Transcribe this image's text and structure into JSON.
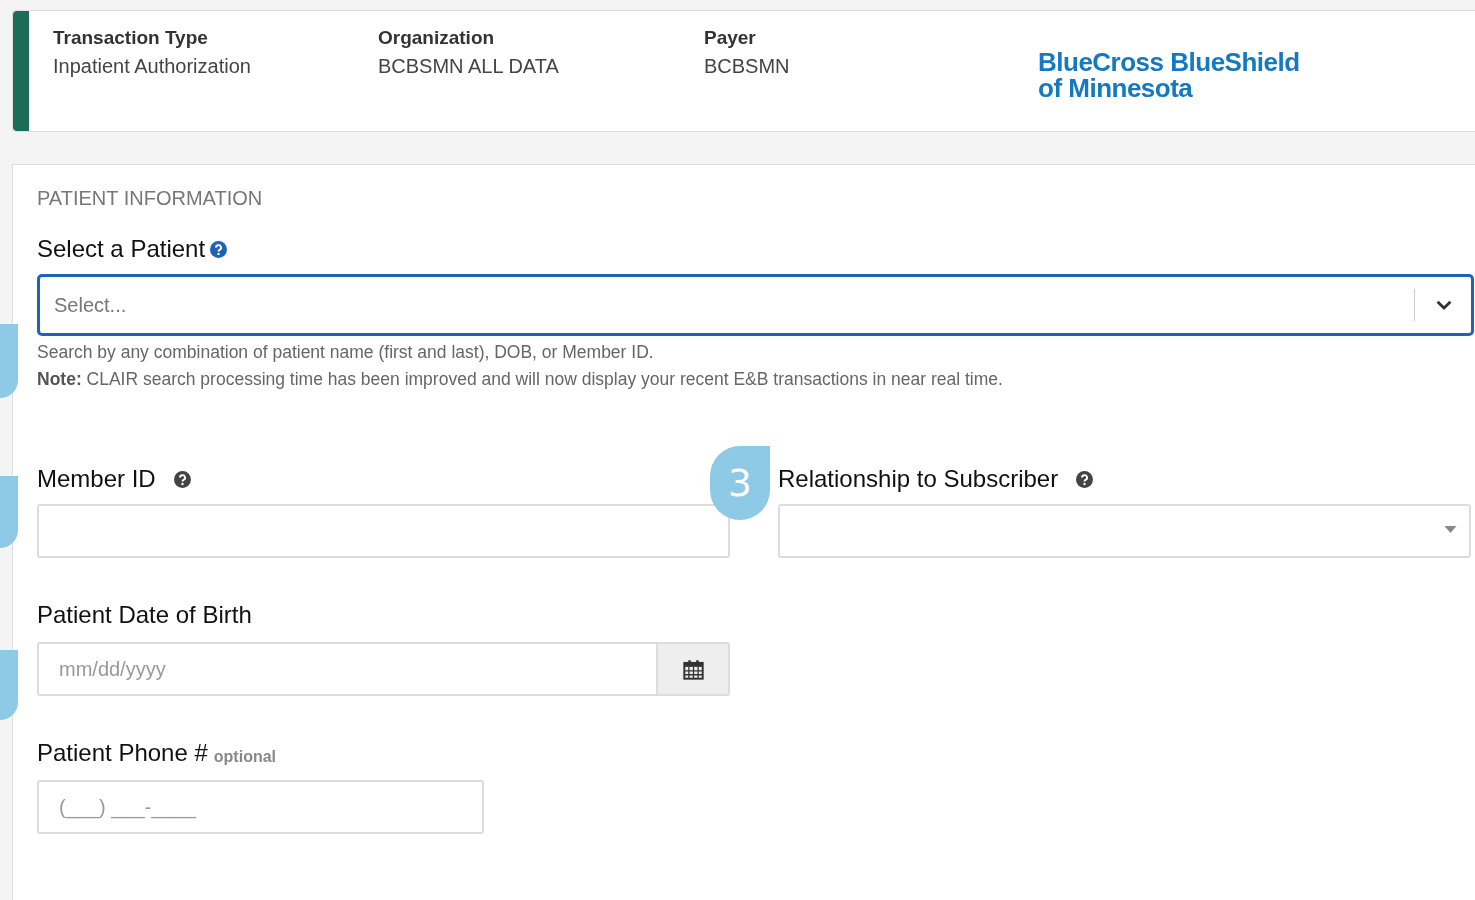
{
  "header": {
    "fields": [
      {
        "label": "Transaction Type",
        "value": "Inpatient Authorization"
      },
      {
        "label": "Organization",
        "value": "BCBSMN ALL DATA"
      },
      {
        "label": "Payer",
        "value": "BCBSMN"
      }
    ],
    "logo_lines": [
      "BlueCross BlueShield",
      "of Minnesota"
    ]
  },
  "section_title": "PATIENT INFORMATION",
  "select_patient": {
    "label": "Select a Patient",
    "placeholder": "Select...",
    "help": [
      "Search by any combination of patient name (first and last), DOB, or Member ID.",
      "**Note:** CLAIR search processing time has been improved and will now display your recent E&B transactions in near real time."
    ]
  },
  "member_id": {
    "label": "Member ID"
  },
  "relationship": {
    "label": "Relationship to Subscriber"
  },
  "callout": {
    "text": "3"
  },
  "dob": {
    "label": "Patient Date of Birth",
    "placeholder": "mm/dd/yyyy"
  },
  "phone": {
    "label": "Patient Phone #",
    "tag": "optional",
    "placeholder": "(___) ___-____"
  }
}
